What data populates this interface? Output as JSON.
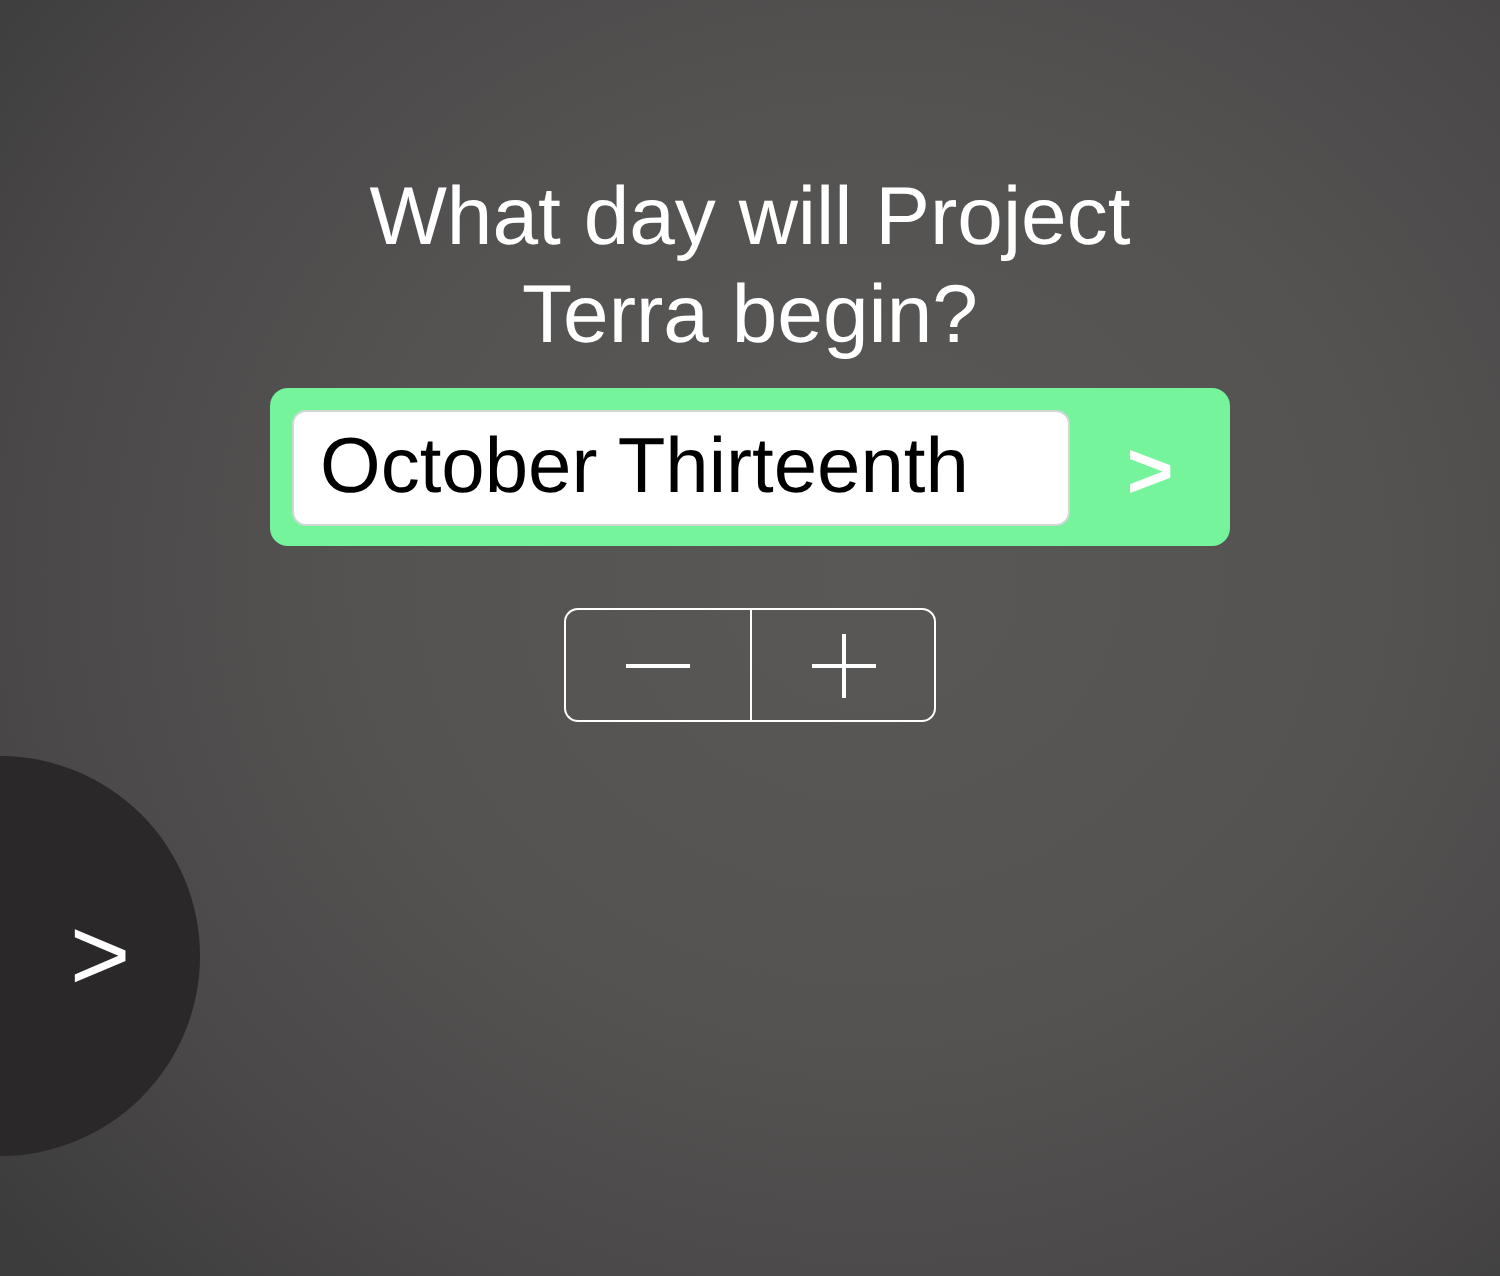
{
  "prompt": {
    "question": "What day will Project Terra begin?"
  },
  "answer": {
    "value": "October Thirteenth",
    "submit_label": ">"
  },
  "side_button": {
    "label": ">"
  }
}
